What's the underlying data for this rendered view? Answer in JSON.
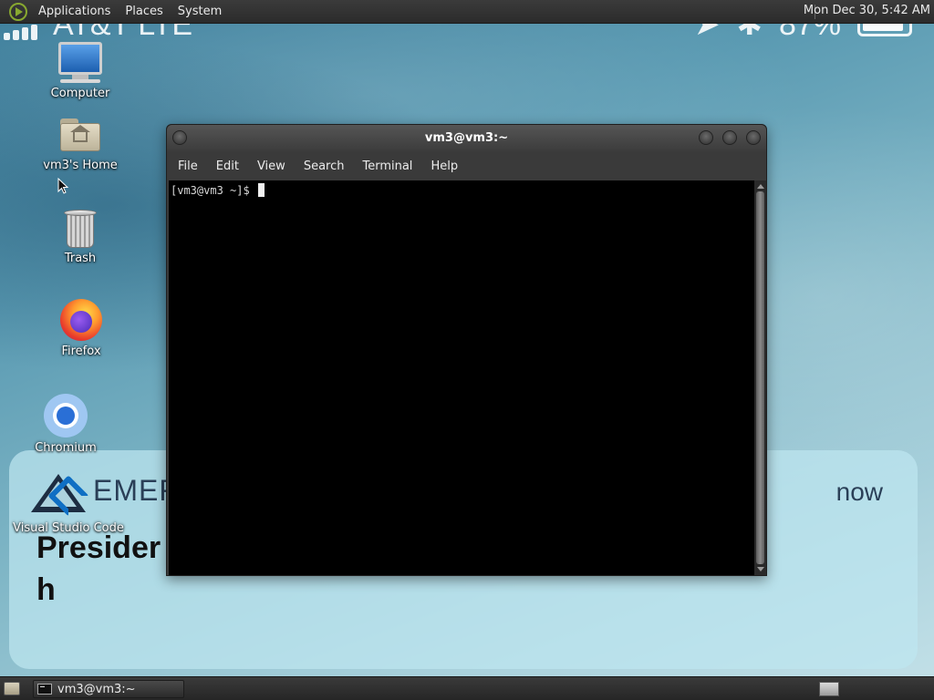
{
  "top_panel": {
    "menus": [
      "Applications",
      "Places",
      "System"
    ],
    "clock": "Mon Dec 30,  5:42 AM"
  },
  "wallpaper": {
    "carrier": "AT&T  LTE",
    "battery": "87%",
    "notification": {
      "brand": "EMER",
      "time": "now",
      "headline_line1": "Presider",
      "headline_line2": "h"
    }
  },
  "desktop_icons": [
    {
      "label": "Computer"
    },
    {
      "label": "vm3's Home"
    },
    {
      "label": "Trash"
    },
    {
      "label": "Firefox"
    },
    {
      "label": "Chromium"
    },
    {
      "label": "Visual Studio Code"
    }
  ],
  "terminal": {
    "title": "vm3@vm3:~",
    "menus": [
      "File",
      "Edit",
      "View",
      "Search",
      "Terminal",
      "Help"
    ],
    "prompt": "[vm3@vm3 ~]$ "
  },
  "taskbar": {
    "task_label": "vm3@vm3:~"
  },
  "colors": {
    "panel_bg": "#2b2b2b",
    "terminal_bg": "#000000",
    "accent_logo": "#88a830"
  }
}
